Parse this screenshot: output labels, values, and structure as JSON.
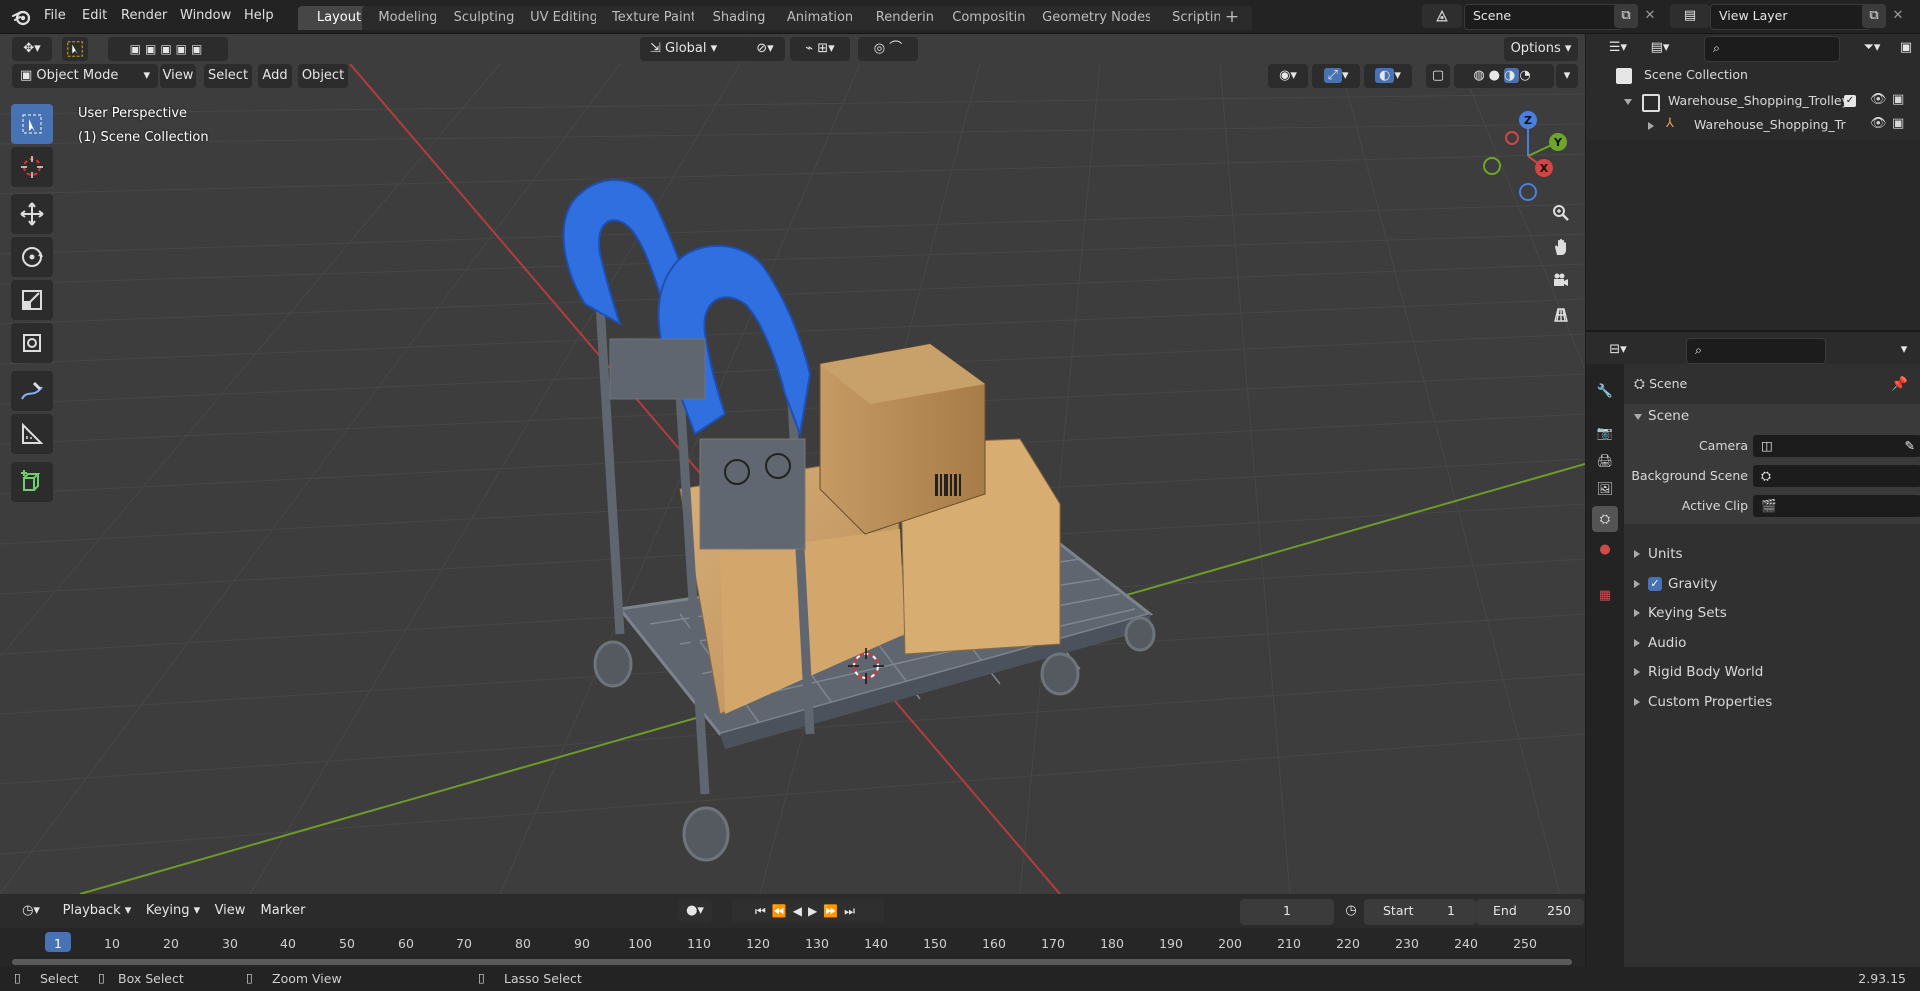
{
  "topbar": {
    "menus": [
      "File",
      "Edit",
      "Render",
      "Window",
      "Help"
    ],
    "workspaces": [
      "Layout",
      "Modeling",
      "Sculpting",
      "UV Editing",
      "Texture Paint",
      "Shading",
      "Animation",
      "Rendering",
      "Compositing",
      "Geometry Nodes",
      "Scripting"
    ],
    "active_workspace": "Layout",
    "scene_name": "Scene",
    "view_layer": "View Layer"
  },
  "viewport": {
    "mode": "Object Mode",
    "menus": [
      "View",
      "Select",
      "Add",
      "Object"
    ],
    "orientation": "Global",
    "options_label": "Options",
    "perspective_label": "User Perspective",
    "collection_label": "(1) Scene Collection",
    "gizmo_axes": [
      "Z",
      "Y",
      "X"
    ]
  },
  "outliner": {
    "root": "Scene Collection",
    "items": [
      {
        "name": "Warehouse_Shopping_Trolley",
        "type": "collection"
      },
      {
        "name": "Warehouse_Shopping_Tr",
        "type": "object"
      }
    ]
  },
  "properties": {
    "context": "Scene",
    "panel_title": "Scene",
    "fields": [
      {
        "label": "Camera",
        "value": ""
      },
      {
        "label": "Background Scene",
        "value": ""
      },
      {
        "label": "Active Clip",
        "value": ""
      }
    ],
    "sections": [
      "Units",
      "Gravity",
      "Keying Sets",
      "Audio",
      "Rigid Body World",
      "Custom Properties"
    ],
    "gravity_checked": true
  },
  "timeline": {
    "menus": [
      "Playback",
      "Keying",
      "View",
      "Marker"
    ],
    "current_frame": "1",
    "start_label": "Start",
    "start": "1",
    "end_label": "End",
    "end": "250",
    "ruler": [
      "1",
      "10",
      "20",
      "30",
      "40",
      "50",
      "60",
      "70",
      "80",
      "90",
      "100",
      "110",
      "120",
      "130",
      "140",
      "150",
      "160",
      "170",
      "180",
      "190",
      "200",
      "210",
      "220",
      "230",
      "240",
      "250"
    ]
  },
  "statusbar": {
    "hints": [
      "Select",
      "Box Select",
      "Zoom View",
      "Lasso Select"
    ],
    "version": "2.93.15"
  },
  "colors": {
    "accent": "#4772b3",
    "x_axis": "#b23d3d",
    "y_axis": "#6f9a2a",
    "trolley_blue": "#2f6fe0"
  }
}
